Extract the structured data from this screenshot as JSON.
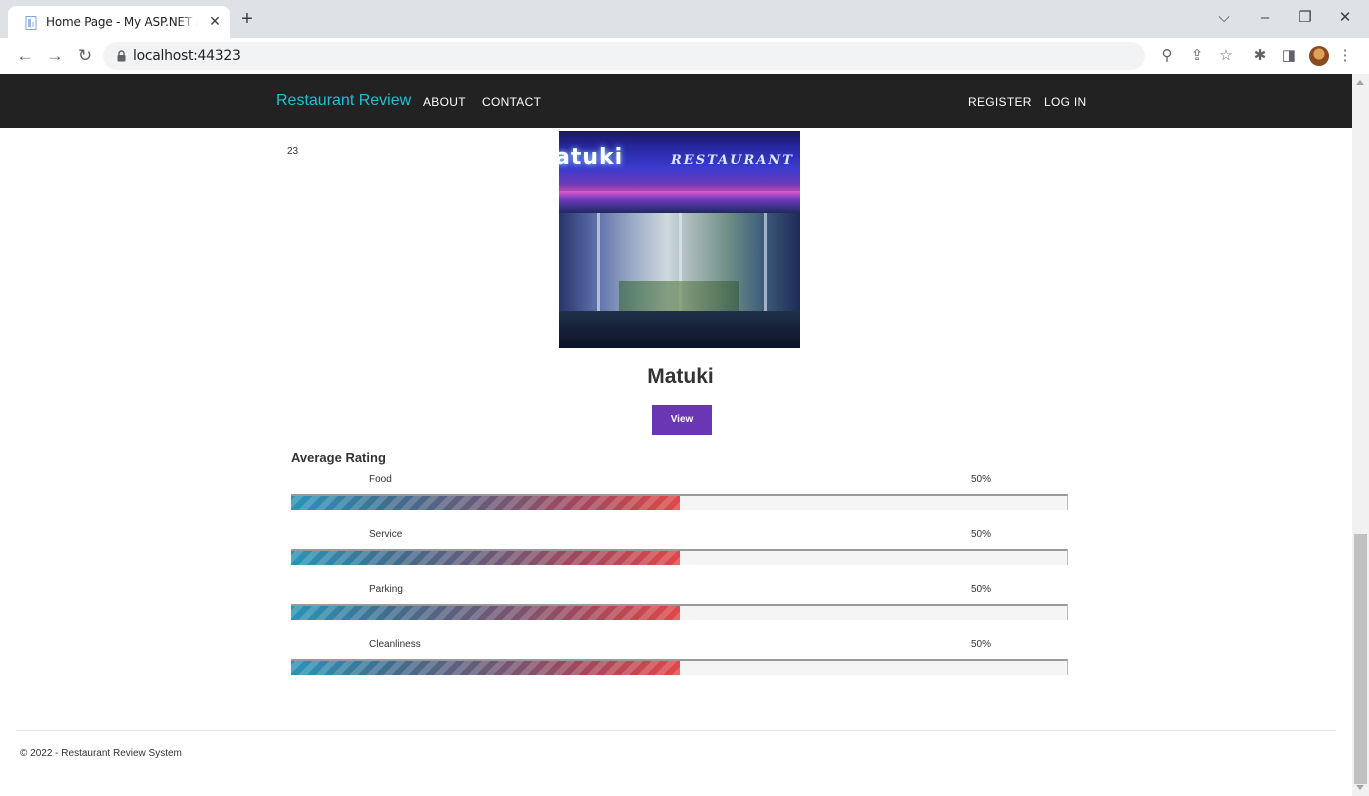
{
  "browser": {
    "tab_title": "Home Page - My ASP.NET Applic",
    "tab_close": "✕",
    "new_tab": "+",
    "url": "localhost:44323",
    "window_controls": [
      "⌵",
      "–",
      "❐",
      "✕"
    ]
  },
  "navbar": {
    "brand": "Restaurant Review",
    "links": [
      "ABOUT",
      "CONTACT"
    ],
    "right_links": [
      "REGISTER",
      "LOG IN"
    ],
    "brand_color": "#1ec2d6"
  },
  "restaurant": {
    "id": "23",
    "photo_sign_text": "atuki",
    "photo_sign_subtext": "RESTAURANT",
    "name": "Matuki",
    "view_label": "View",
    "view_color": "#6a36b4"
  },
  "ratings": {
    "title": "Average Rating",
    "items": [
      {
        "label": "Food",
        "percent_text": "50%",
        "value": 50
      },
      {
        "label": "Service",
        "percent_text": "50%",
        "value": 50
      },
      {
        "label": "Parking",
        "percent_text": "50%",
        "value": 50
      },
      {
        "label": "Cleanliness",
        "percent_text": "50%",
        "value": 50
      }
    ]
  },
  "footer": {
    "text": "© 2022 - Restaurant Review System"
  }
}
